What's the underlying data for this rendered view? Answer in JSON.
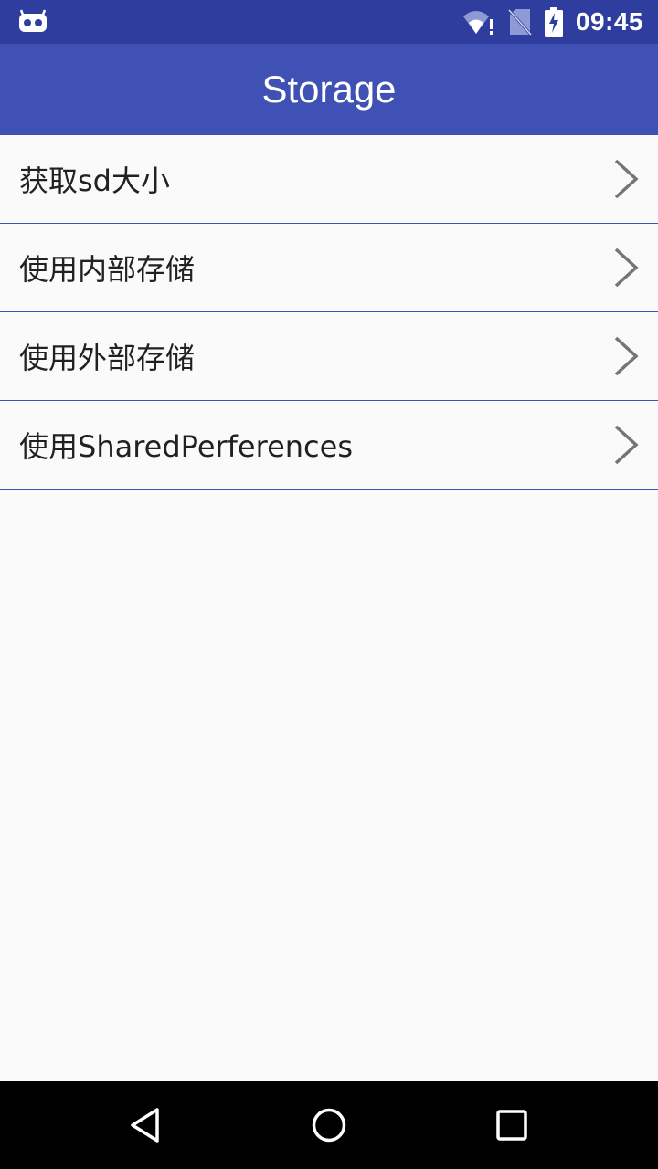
{
  "status_bar": {
    "time": "09:45",
    "icons": [
      "debug-bot-icon",
      "wifi-alert-icon",
      "no-sim-icon",
      "battery-charging-icon"
    ]
  },
  "app_bar": {
    "title": "Storage"
  },
  "list": {
    "items": [
      {
        "label": "获取sd大小"
      },
      {
        "label": "使用内部存储"
      },
      {
        "label": "使用外部存储"
      },
      {
        "label": "使用SharedPerferences"
      }
    ]
  },
  "nav_bar": {
    "icons": [
      "back-icon",
      "home-icon",
      "recents-icon"
    ]
  },
  "colors": {
    "status_bar": "#2f3e9e",
    "app_bar": "#3f51b5",
    "divider": "#3f51b5",
    "background": "#fafafa"
  }
}
